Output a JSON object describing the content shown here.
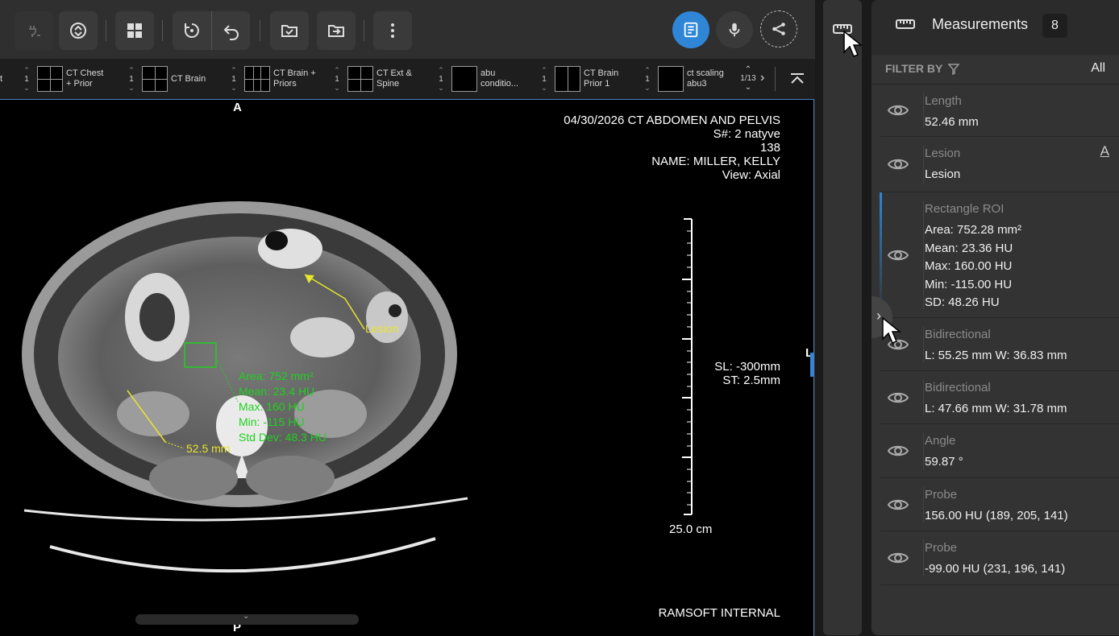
{
  "toolbar": {
    "buttons": [
      "plug-icon",
      "scroll-sync-icon",
      "layout-grid-icon",
      "reset-icon",
      "undo-icon",
      "save-check-icon",
      "export-icon",
      "more-vert-icon"
    ],
    "report_icon": "report-icon",
    "mic_icon": "microphone-icon",
    "share_icon": "share-icon"
  },
  "series_strip": [
    {
      "count": "1",
      "label": "CT Chest\n+ Prior",
      "grid": "g4"
    },
    {
      "count": "1",
      "label": "CT Brain",
      "grid": "g4"
    },
    {
      "count": "1",
      "label": "CT Brain +\nPriors",
      "grid": "g6"
    },
    {
      "count": "1",
      "label": "CT Ext &\nSpine",
      "grid": "g4"
    },
    {
      "count": "1",
      "label": "abu\nconditio...",
      "grid": "none"
    },
    {
      "count": "1",
      "label": "CT Brain\nPrior 1",
      "grid": "g2"
    },
    {
      "count": "1",
      "label": "ct scaling\nabu3",
      "grid": "none"
    }
  ],
  "strip_left_fragment": "t",
  "strip_page": "1/13",
  "viewport": {
    "orientation_top": "A",
    "orientation_bottom": "P",
    "orientation_right": "L",
    "overlay_top_right": {
      "line1": "04/30/2026  CT ABDOMEN AND PELVIS",
      "line2": "S#: 2  natyve",
      "line3": "138",
      "line4": "NAME: MILLER, KELLY",
      "line5": "View: Axial"
    },
    "slice_location": "SL: -300mm",
    "slice_thickness": "ST: 2.5mm",
    "scale_label": "25.0 cm",
    "institution": "RAMSOFT INTERNAL",
    "annotations": {
      "lesion_label": "Lesion",
      "length_label": "52.5 mm",
      "roi_area": "Area: 752 mm²",
      "roi_mean": "Mean: 23.4 HU",
      "roi_max": "Max: 160 HU",
      "roi_min": "Min: -115 HU",
      "roi_sd": "Std Dev: 48.3 HU"
    }
  },
  "panel": {
    "title": "Measurements",
    "count": "8",
    "filter_label": "FILTER BY",
    "filter_value": "All",
    "items": [
      {
        "title": "Length",
        "values": [
          "52.46 mm"
        ]
      },
      {
        "title": "Lesion",
        "values": [
          "Lesion"
        ]
      },
      {
        "title": "Rectangle ROI",
        "values": [
          "Area: 752.28 mm²",
          "Mean: 23.36 HU",
          "Max: 160.00 HU",
          "Min: -115.00 HU",
          "SD: 48.26 HU"
        ]
      },
      {
        "title": "Bidirectional",
        "values": [
          "L: 55.25 mm W: 36.83 mm"
        ]
      },
      {
        "title": "Bidirectional",
        "values": [
          "L: 47.66 mm W: 31.78 mm"
        ]
      },
      {
        "title": "Angle",
        "values": [
          "59.87 °"
        ]
      },
      {
        "title": "Probe",
        "values": [
          "156.00 HU (189, 205, 141)"
        ]
      },
      {
        "title": "Probe",
        "values": [
          "-99.00 HU (231, 196, 141)"
        ]
      }
    ]
  },
  "colors": {
    "accent": "#2f86d6",
    "annotation_yellow": "#e6e62e",
    "annotation_green": "#1fd11f"
  }
}
